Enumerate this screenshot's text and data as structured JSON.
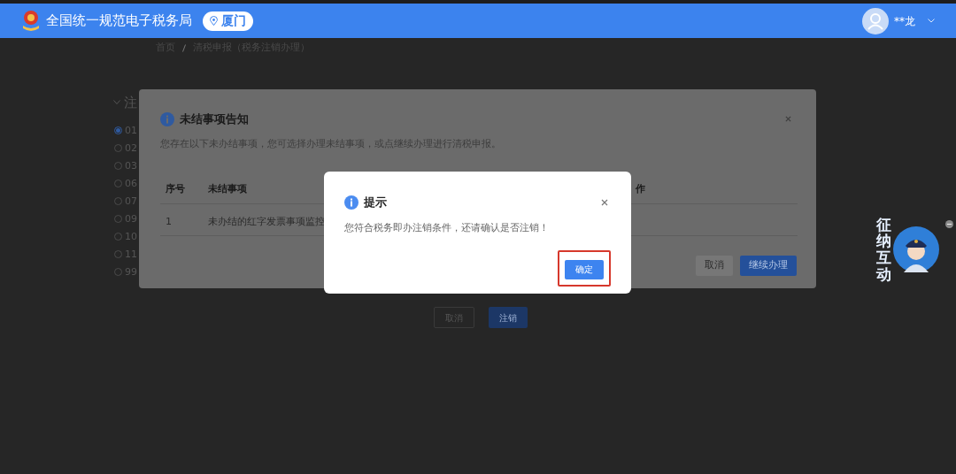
{
  "header": {
    "title": "全国统一规范电子税务局",
    "city": "厦门",
    "user": "**龙"
  },
  "breadcrumb": [
    "首页",
    "清税申报（税务注销办理）"
  ],
  "section": {
    "title": "注",
    "expanded": true,
    "options": [
      {
        "label": "01",
        "selected": true
      },
      {
        "label": "02",
        "selected": false
      },
      {
        "label": "03",
        "selected": false
      },
      {
        "label": "06",
        "selected": false
      },
      {
        "label": "07",
        "selected": false
      },
      {
        "label": "09",
        "selected": false
      },
      {
        "label": "10",
        "selected": false
      },
      {
        "label": "11",
        "selected": false
      },
      {
        "label": "99",
        "selected": false
      }
    ]
  },
  "page_buttons": [
    "取消",
    "注销"
  ],
  "notice_dialog": {
    "title": "未结事项告知",
    "description": "您存在以下未办结事项，您可选择办理未结事项，或点继续办理进行清税申报。",
    "columns": [
      "序号",
      "未结事项",
      "作"
    ],
    "rows": [
      [
        "1",
        "未办结的红字发票事项监控"
      ]
    ],
    "buttons": [
      "取消",
      "继续办理"
    ]
  },
  "prompt_dialog": {
    "title": "提示",
    "message": "您符合税务即办注销条件，还请确认是否注销！",
    "confirm": "确定",
    "highlighted": true
  },
  "assistant": {
    "label": "征纳互动"
  }
}
